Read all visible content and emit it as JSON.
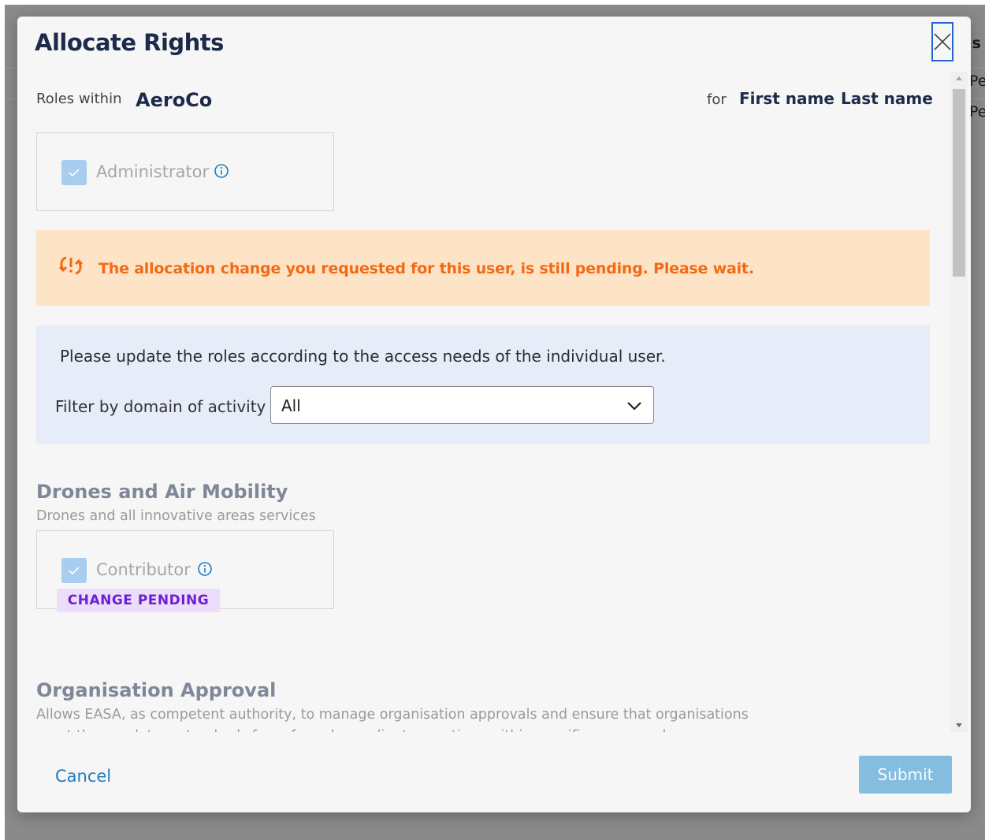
{
  "background": {
    "rows": [
      "Pe",
      "Pe"
    ],
    "header_fragment": "us"
  },
  "modal": {
    "title": "Allocate Rights",
    "close_icon": "close-icon",
    "roles_within_label": "Roles within",
    "organisation": "AeroCo",
    "for_label": "for",
    "first_name": "First name",
    "last_name": "Last name",
    "admin_role": {
      "label": "Administrator",
      "checked": true,
      "disabled": true
    },
    "warning": {
      "icon": "pending-refresh-icon",
      "text": "The allocation change you requested for this user, is still pending. Please wait.",
      "color": "#f26a17"
    },
    "instructions": "Please update the roles according to the access needs of the individual user.",
    "filter": {
      "label": "Filter by domain of activity",
      "selected": "All"
    },
    "sections": [
      {
        "title": "Drones and Air Mobility",
        "description": "Drones and all innovative areas services",
        "roles": [
          {
            "label": "Contributor",
            "checked": true,
            "disabled": true,
            "badge": "CHANGE PENDING"
          }
        ]
      },
      {
        "title": "Organisation Approval",
        "description_lines": [
          "Allows EASA, as competent authority, to manage organisation approvals and ensure that organisations",
          "meet the regulatory standards for safe and compliant operations within specific areas, such as"
        ]
      }
    ],
    "footer": {
      "cancel_label": "Cancel",
      "submit_label": "Submit"
    }
  },
  "colors": {
    "title": "#1c2b4a",
    "accent_blue": "#2a8fd0",
    "badge_bg": "#ecdefa",
    "badge_text": "#6d1fd3",
    "warning_bg": "#fde4c6",
    "info_bg": "#e6ecf8"
  }
}
